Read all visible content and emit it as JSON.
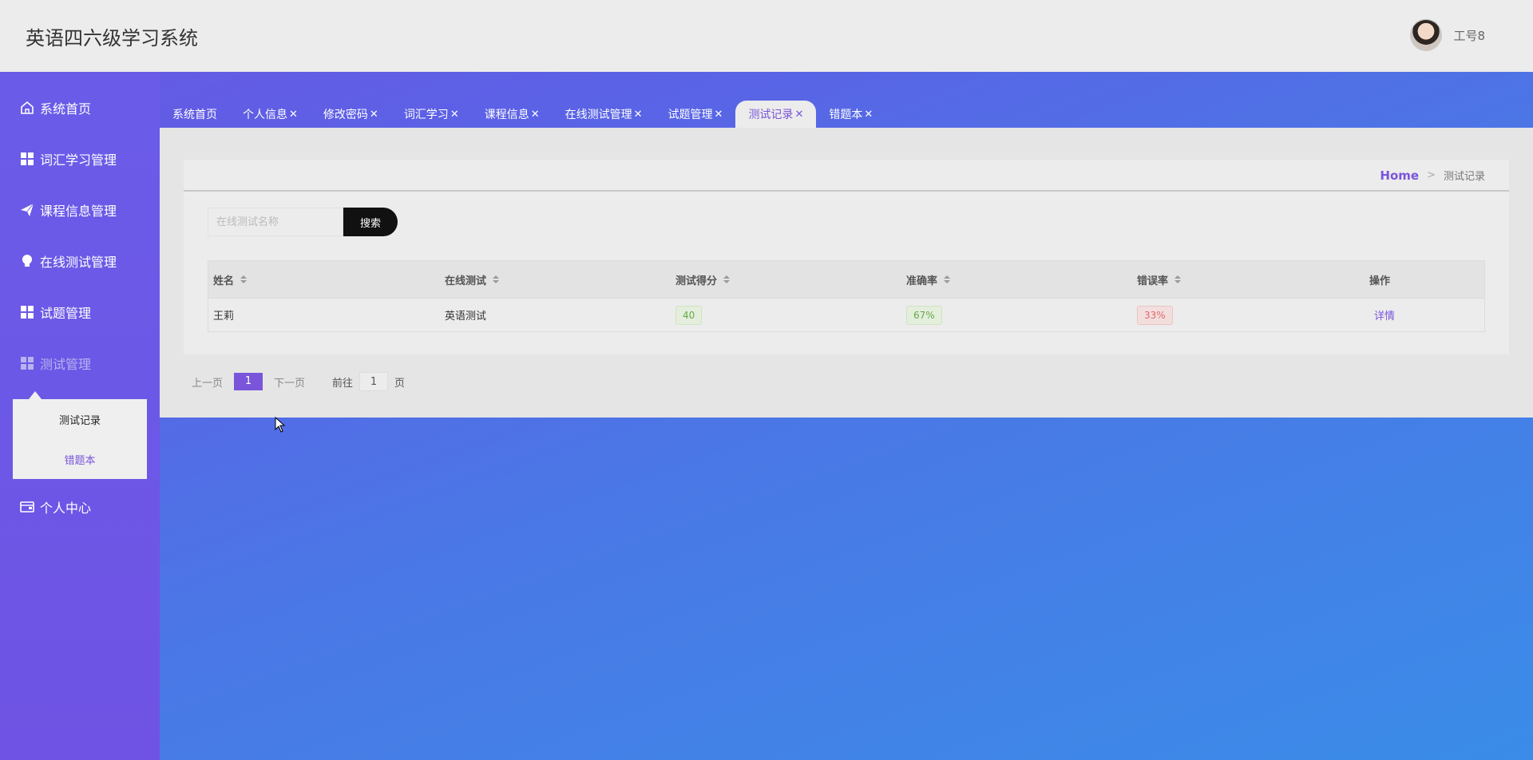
{
  "header": {
    "title": "英语四六级学习系统",
    "user_name": "工号8"
  },
  "sidebar": {
    "items": [
      {
        "label": "系统首页",
        "icon": "home-icon"
      },
      {
        "label": "词汇学习管理",
        "icon": "grid-icon"
      },
      {
        "label": "课程信息管理",
        "icon": "paper-plane-icon"
      },
      {
        "label": "在线测试管理",
        "icon": "bulb-icon"
      },
      {
        "label": "试题管理",
        "icon": "grid-icon"
      },
      {
        "label": "测试管理",
        "icon": "grid-icon"
      },
      {
        "label": "个人中心",
        "icon": "card-icon"
      }
    ],
    "submenu": [
      {
        "label": "测试记录"
      },
      {
        "label": "错题本"
      }
    ]
  },
  "tabs": [
    {
      "label": "系统首页",
      "closable": false
    },
    {
      "label": "个人信息",
      "closable": true
    },
    {
      "label": "修改密码",
      "closable": true
    },
    {
      "label": "词汇学习",
      "closable": true
    },
    {
      "label": "课程信息",
      "closable": true
    },
    {
      "label": "在线测试管理",
      "closable": true
    },
    {
      "label": "试题管理",
      "closable": true
    },
    {
      "label": "测试记录",
      "closable": true,
      "active": true
    },
    {
      "label": "错题本",
      "closable": true
    }
  ],
  "tab_close": "✕",
  "breadcrumb": {
    "home": "Home",
    "sep": ">",
    "current": "测试记录"
  },
  "search": {
    "placeholder": "在线测试名称",
    "button": "搜索"
  },
  "table": {
    "columns": [
      "姓名",
      "在线测试",
      "测试得分",
      "准确率",
      "错误率",
      "操作"
    ],
    "rows": [
      {
        "name": "王莉",
        "test": "英语测试",
        "score": "40",
        "accuracy": "67%",
        "error_rate": "33%",
        "action": "详情"
      }
    ]
  },
  "pager": {
    "prev": "上一页",
    "current": "1",
    "next": "下一页",
    "goto_prefix": "前往",
    "goto_value": "1",
    "goto_suffix": "页"
  },
  "colors": {
    "accent": "#7a55d9",
    "sidebar": "#6a5ce8",
    "header": "#ececec"
  }
}
